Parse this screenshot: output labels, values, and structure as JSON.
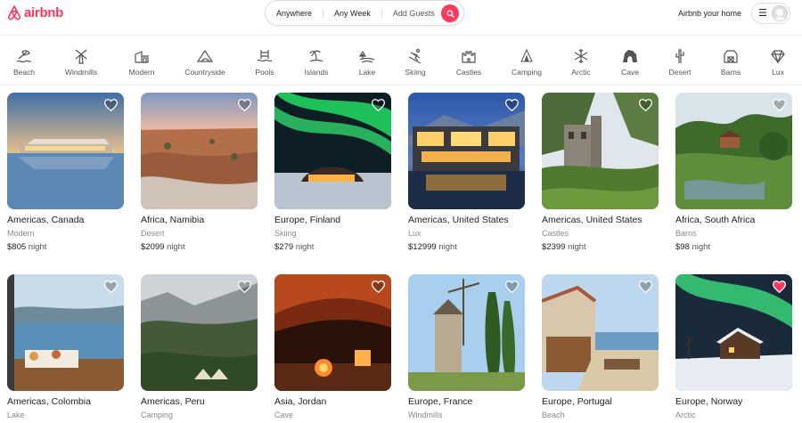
{
  "brand": {
    "name": "airbnb",
    "color": "#ff385c"
  },
  "search": {
    "where": "Anywhere",
    "when": "Any Week",
    "who": "Add Guests"
  },
  "header": {
    "host_link": "Airbnb your home"
  },
  "categories": [
    {
      "label": "Beach",
      "icon": "beach-icon"
    },
    {
      "label": "Windmills",
      "icon": "windmill-icon"
    },
    {
      "label": "Modern",
      "icon": "modern-icon"
    },
    {
      "label": "Countryside",
      "icon": "countryside-icon"
    },
    {
      "label": "Pools",
      "icon": "pool-icon"
    },
    {
      "label": "Islands",
      "icon": "island-icon"
    },
    {
      "label": "Lake",
      "icon": "lake-icon"
    },
    {
      "label": "Skiing",
      "icon": "skiing-icon"
    },
    {
      "label": "Castles",
      "icon": "castle-icon"
    },
    {
      "label": "Camping",
      "icon": "camping-icon"
    },
    {
      "label": "Arctic",
      "icon": "arctic-icon"
    },
    {
      "label": "Cave",
      "icon": "cave-icon"
    },
    {
      "label": "Desert",
      "icon": "desert-icon"
    },
    {
      "label": "Barns",
      "icon": "barn-icon"
    },
    {
      "label": "Lux",
      "icon": "diamond-icon"
    }
  ],
  "listings": [
    {
      "location": "Americas, Canada",
      "category": "Modern",
      "price": "$805",
      "unit": "night",
      "favorited": false
    },
    {
      "location": "Africa, Namibia",
      "category": "Desert",
      "price": "$2099",
      "unit": "night",
      "favorited": false
    },
    {
      "location": "Europe, Finland",
      "category": "Skiing",
      "price": "$279",
      "unit": "night",
      "favorited": false
    },
    {
      "location": "Americas, United States",
      "category": "Lux",
      "price": "$12999",
      "unit": "night",
      "favorited": false
    },
    {
      "location": "Americas, United States",
      "category": "Castles",
      "price": "$2399",
      "unit": "night",
      "favorited": false
    },
    {
      "location": "Africa, South Africa",
      "category": "Barns",
      "price": "$98",
      "unit": "night",
      "favorited": false
    },
    {
      "location": "Americas, Colombia",
      "category": "Lake",
      "price": "",
      "unit": "",
      "favorited": false
    },
    {
      "location": "Americas, Peru",
      "category": "Camping",
      "price": "",
      "unit": "",
      "favorited": false
    },
    {
      "location": "Asia, Jordan",
      "category": "Cave",
      "price": "",
      "unit": "",
      "favorited": false
    },
    {
      "location": "Europe, France",
      "category": "Windmills",
      "price": "",
      "unit": "",
      "favorited": false
    },
    {
      "location": "Europe, Portugal",
      "category": "Beach",
      "price": "",
      "unit": "",
      "favorited": false
    },
    {
      "location": "Europe, Norway",
      "category": "Arctic",
      "price": "",
      "unit": "",
      "favorited": true
    }
  ],
  "colors": {
    "text": "#222222",
    "muted": "#8a8a8a",
    "heart_active": "#ff385c"
  }
}
